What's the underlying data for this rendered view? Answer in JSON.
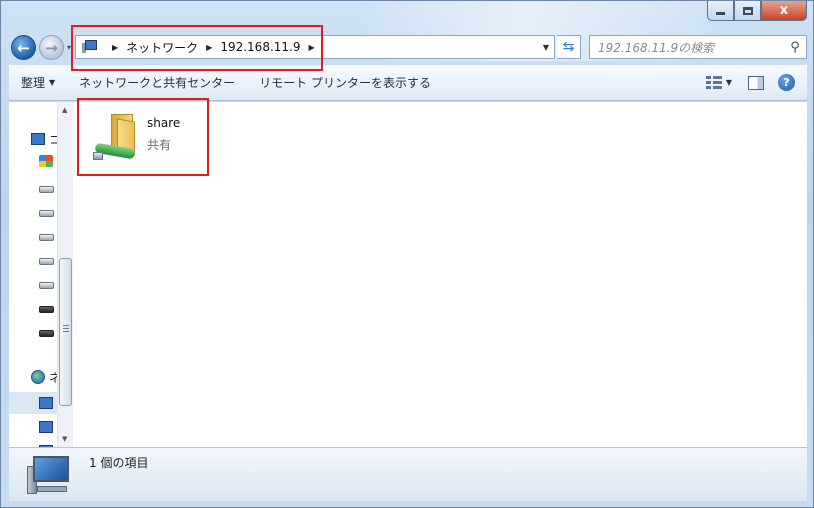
{
  "window": {
    "close_glyph": "x"
  },
  "nav": {
    "back_glyph": "←",
    "forward_glyph": "→"
  },
  "address": {
    "crumbs": [
      "ネットワーク",
      "192.168.11.9"
    ]
  },
  "search": {
    "placeholder": "192.168.11.9の検索"
  },
  "toolbar": {
    "organize_label": "整理",
    "network_center_label": "ネットワークと共有センター",
    "remote_printers_label": "リモート プリンターを表示する"
  },
  "sidebar": {
    "labels": [
      "コ",
      "ネ"
    ],
    "icons": [
      "computer-icon",
      "windows-drive-icon",
      "drive-icon",
      "drive-icon",
      "drive-icon",
      "drive-icon",
      "drive-icon",
      "drive-icon",
      "drive-icon",
      "network-icon",
      "computer-icon",
      "computer-icon",
      "computer-icon"
    ]
  },
  "content": {
    "items": [
      {
        "name": "share",
        "subtitle": "共有",
        "icon": "shared-folder-icon"
      }
    ]
  },
  "details": {
    "status": "1 個の項目"
  },
  "colors": {
    "annotation": "#e01e1e",
    "frame": "#bcd4ee"
  }
}
